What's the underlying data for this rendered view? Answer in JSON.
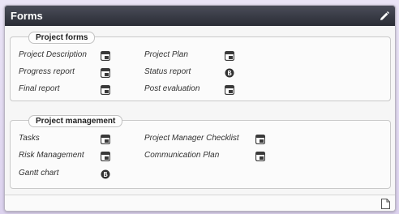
{
  "panel": {
    "title": "Forms",
    "header_icon": "pencil-icon",
    "footer_icon": "document-icon",
    "header_color": "#2e3039"
  },
  "groups": [
    {
      "title": "Project forms",
      "items": [
        {
          "label": "Project Description",
          "icon": "form-icon"
        },
        {
          "label": "Project Plan",
          "icon": "form-icon"
        },
        {
          "label": "Progress report",
          "icon": "form-icon"
        },
        {
          "label": "Status report",
          "icon": "status-dot-icon"
        },
        {
          "label": "Final report",
          "icon": "form-icon"
        },
        {
          "label": "Post evaluation",
          "icon": "form-icon"
        }
      ]
    },
    {
      "title": "Project management",
      "items": [
        {
          "label": "Tasks",
          "icon": "form-icon"
        },
        {
          "label": "Project Manager Checklist",
          "icon": "form-icon"
        },
        {
          "label": "Risk Management",
          "icon": "form-icon"
        },
        {
          "label": "Communication Plan",
          "icon": "form-icon"
        },
        {
          "label": "Gantt chart",
          "icon": "status-dot-icon"
        }
      ]
    }
  ]
}
